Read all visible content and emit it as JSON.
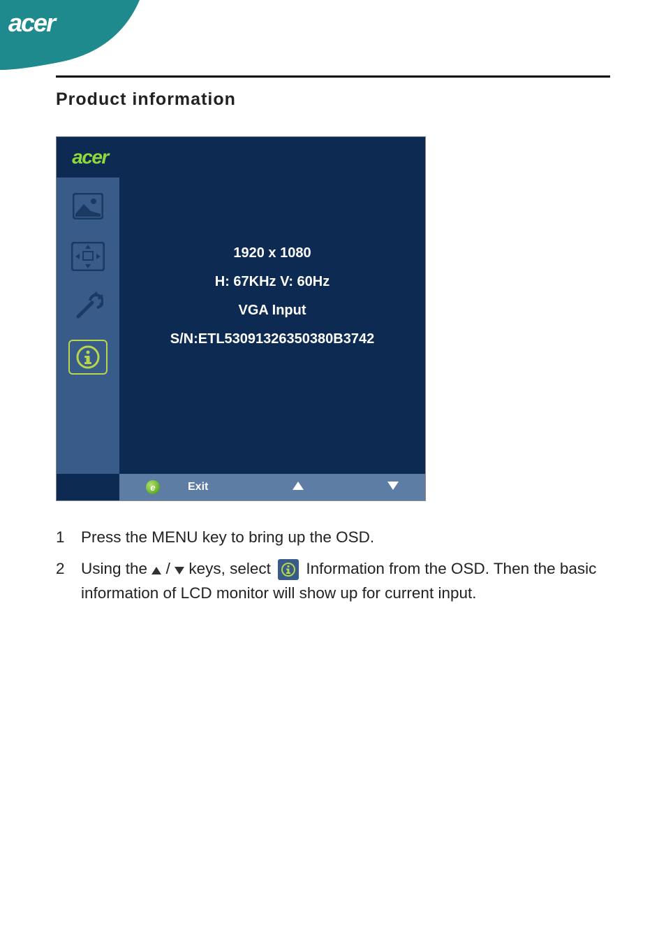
{
  "brand": "acer",
  "section_title": "Product information",
  "osd": {
    "brand": "acer",
    "info": {
      "resolution": "1920 x 1080",
      "freq": "H: 67KHz   V: 60Hz",
      "input": "VGA Input",
      "serial": "S/N:ETL53091326350380B3742"
    },
    "footer": {
      "exit": "Exit"
    }
  },
  "steps": {
    "1": {
      "num": "1",
      "text": "Press the MENU key to bring up the OSD."
    },
    "2": {
      "num": "2",
      "prefix": "Using the ",
      "mid1": " / ",
      "mid2": " keys, select ",
      "suffix": " Information from the OSD. Then the basic information of LCD monitor will show up for current input."
    }
  }
}
